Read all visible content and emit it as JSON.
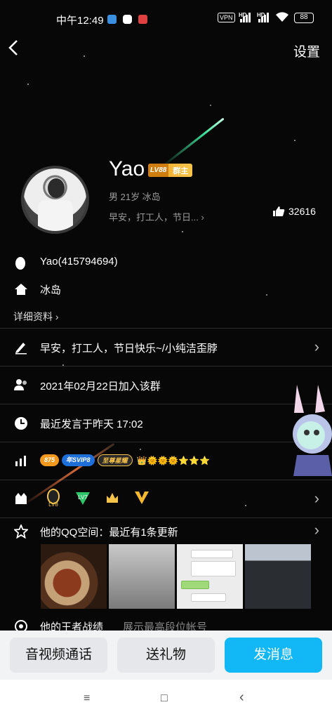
{
  "status_bar": {
    "time": "中午12:49",
    "vpn": "VPN",
    "hd": "HD",
    "battery": "88"
  },
  "nav": {
    "back_glyph": "‹",
    "settings": "设置"
  },
  "profile": {
    "name": "Yao",
    "level": "LV88",
    "level_title": "群主",
    "subinfo": "男 21岁 冰岛",
    "signature": "早安，打工人，节日...  ›",
    "likes": "32616"
  },
  "info": {
    "qq": "Yao(415794694)",
    "location": "冰岛",
    "details_link": "详细资料 ›"
  },
  "rows": {
    "signature_full": "早安，打工人，节日快乐~/小纯洁歪脖",
    "joined": "2021年02月22日加入该群",
    "last_spoke": "最近发言于昨天 17:02",
    "qzone": "他的QQ空间：最近有1条更新",
    "game_label": "他的王者战绩",
    "game_sub": "展示最高段位帐号"
  },
  "badges": {
    "coin": "875",
    "svip": "年SVIP8",
    "star": "至尊星耀",
    "crowns": "👑🌞🌞🌞⭐⭐⭐"
  },
  "level_icons": [
    "LV8",
    "LV7"
  ],
  "buttons": {
    "call": "音视频通话",
    "gift": "送礼物",
    "send": "发消息"
  },
  "navbar": {
    "menu": "≡",
    "home": "□",
    "back": "‹"
  },
  "colors": {
    "accent": "#12b7f5",
    "level_badge": "#f3a424"
  }
}
